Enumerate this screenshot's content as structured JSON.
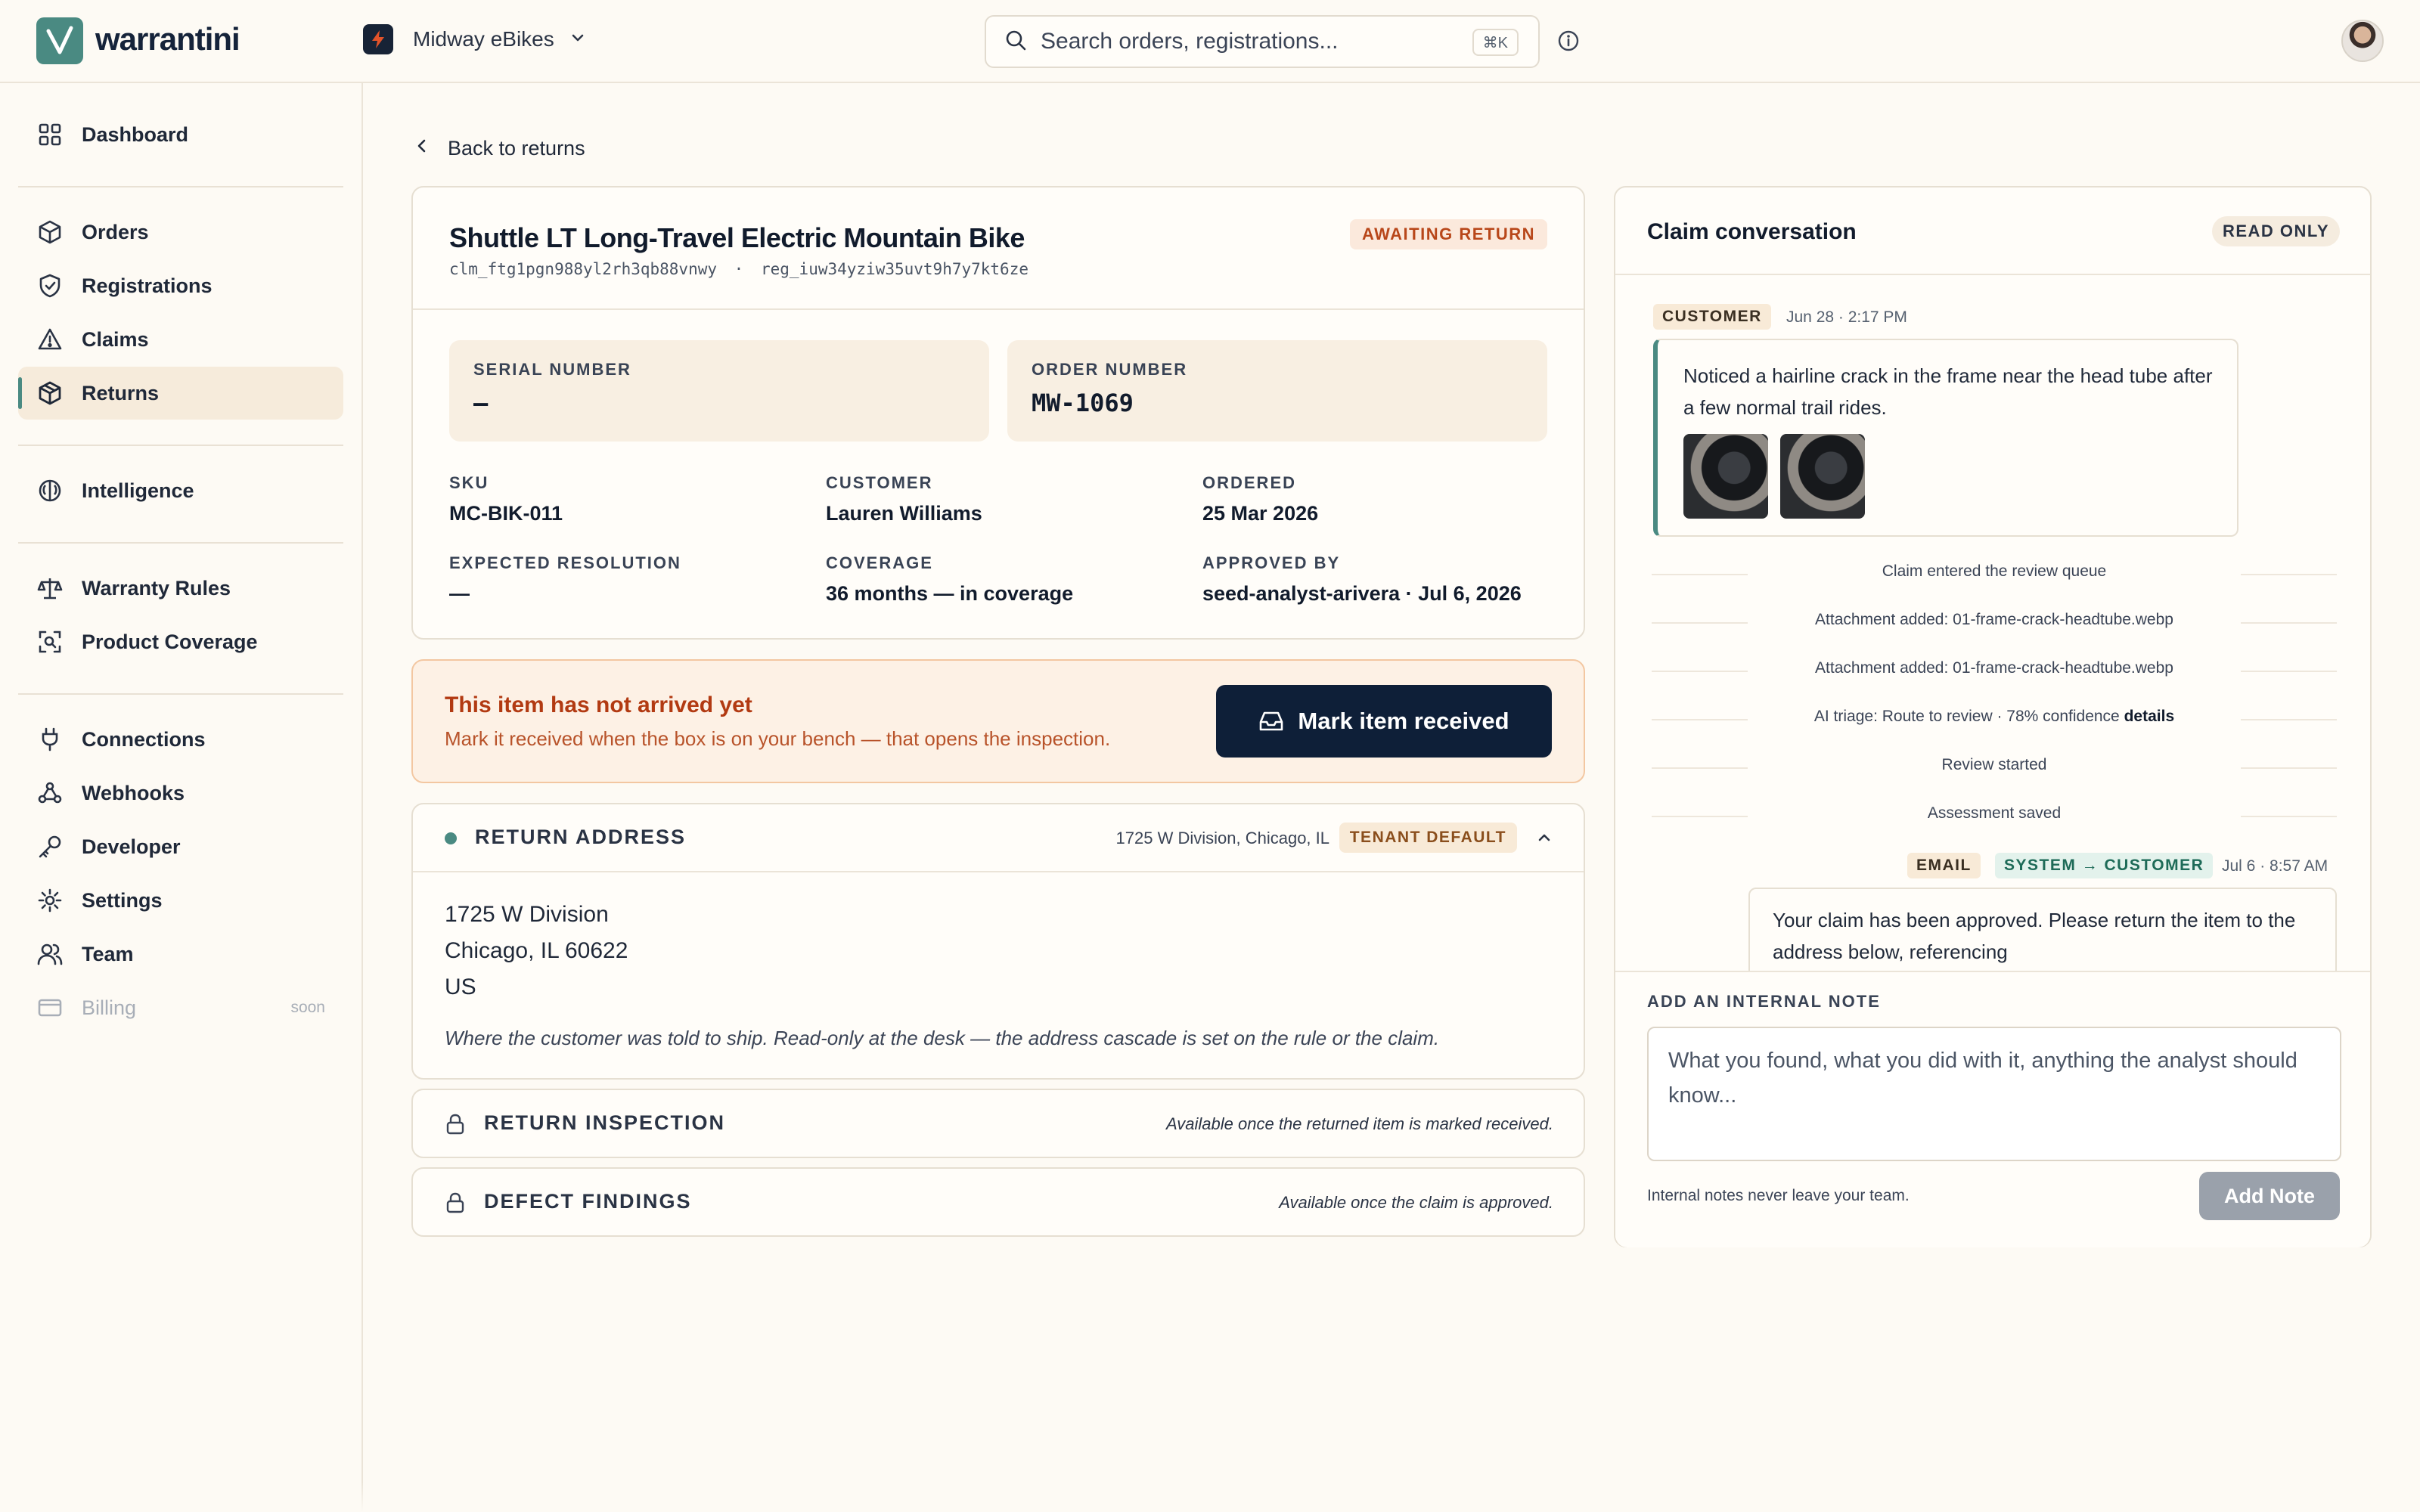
{
  "app": {
    "brand": "warrantini",
    "brand_color": "#4a8a82",
    "tenant": "Midway eBikes",
    "search_placeholder": "Search orders, registrations...",
    "search_shortcut": "⌘K"
  },
  "sidebar": {
    "items": [
      {
        "label": "Dashboard",
        "icon": "grid-icon"
      },
      {
        "label": "Orders",
        "icon": "box-icon"
      },
      {
        "label": "Registrations",
        "icon": "shield-check-icon"
      },
      {
        "label": "Claims",
        "icon": "warning-triangle-icon"
      },
      {
        "label": "Returns",
        "icon": "package-return-icon",
        "active": true
      },
      {
        "label": "Intelligence",
        "icon": "brain-icon"
      },
      {
        "label": "Warranty Rules",
        "icon": "scale-icon"
      },
      {
        "label": "Product Coverage",
        "icon": "scan-search-icon"
      },
      {
        "label": "Connections",
        "icon": "plug-icon"
      },
      {
        "label": "Webhooks",
        "icon": "webhook-icon"
      },
      {
        "label": "Developer",
        "icon": "key-icon"
      },
      {
        "label": "Settings",
        "icon": "gear-icon"
      },
      {
        "label": "Team",
        "icon": "users-icon"
      },
      {
        "label": "Billing",
        "icon": "credit-card-icon",
        "disabled": true,
        "tag": "soon"
      }
    ]
  },
  "main": {
    "back_label": "Back to returns",
    "product": {
      "title": "Shuttle LT Long-Travel Electric Mountain Bike",
      "claim_id": "clm_ftg1pgn988yl2rh3qb88vnwy",
      "separator": "·",
      "registration_id": "reg_iuw34yziw35uvt9h7y7kt6ze",
      "status": "AWAITING RETURN",
      "serial_number_label": "SERIAL NUMBER",
      "serial_number": "—",
      "order_number_label": "ORDER NUMBER",
      "order_number": "MW-1069",
      "fields": [
        {
          "label": "SKU",
          "value": "MC-BIK-011"
        },
        {
          "label": "CUSTOMER",
          "value": "Lauren Williams"
        },
        {
          "label": "ORDERED",
          "value": "25 Mar 2026"
        },
        {
          "label": "EXPECTED RESOLUTION",
          "value": "—"
        },
        {
          "label": "COVERAGE",
          "value": "36 months — in coverage"
        },
        {
          "label": "APPROVED BY",
          "value": "seed-analyst-arivera · Jul 6, 2026"
        }
      ]
    },
    "alert": {
      "title": "This item has not arrived yet",
      "text": "Mark it received when the box is on your bench — that opens the inspection.",
      "button": "Mark item received"
    },
    "return_address": {
      "title": "RETURN ADDRESS",
      "summary": "1725 W Division, Chicago, IL",
      "badge": "TENANT DEFAULT",
      "line1": "1725 W Division",
      "line2": "Chicago, IL 60622",
      "line3": "US",
      "note": "Where the customer was told to ship. Read-only at the desk — the address cascade is set on the rule or the claim."
    },
    "return_inspection": {
      "title": "RETURN INSPECTION",
      "hint": "Available once the returned item is marked received."
    },
    "defect_findings": {
      "title": "DEFECT FINDINGS",
      "hint": "Available once the claim is approved."
    }
  },
  "conversation": {
    "title": "Claim conversation",
    "badge": "READ ONLY",
    "customer_chip": "CUSTOMER",
    "customer_time": "Jun 28 · 2:17 PM",
    "customer_message": "Noticed a hairline crack in the frame near the head tube after a few normal trail rides.",
    "events": [
      "Claim entered the review queue",
      "Attachment added: 01-frame-crack-headtube.webp",
      "Attachment added: 01-frame-crack-headtube.webp",
      "AI triage: Route to review · 78% confidence",
      "Review started",
      "Assessment saved"
    ],
    "triage_details_link": "details",
    "email_chip": "EMAIL",
    "system_chip": "SYSTEM → CUSTOMER",
    "email_time": "Jul 6 · 8:57 AM",
    "email_message": "Your claim has been approved. Please return the item to the address below, referencing",
    "note_label": "ADD AN INTERNAL NOTE",
    "note_placeholder": "What you found, what you did with it, anything the analyst should know...",
    "note_hint": "Internal notes never leave your team.",
    "add_note_button": "Add Note"
  }
}
